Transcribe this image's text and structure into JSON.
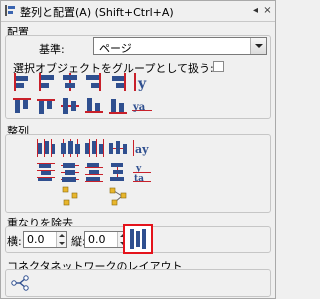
{
  "panel": {
    "title": "整列と配置(A) (Shift+Ctrl+A)",
    "title_icon": "align-panel-icon",
    "menu_button": "◂",
    "close_button": "×"
  },
  "arrange": {
    "section_label": "配置",
    "basis_label": "基準:",
    "basis_value": "ページ",
    "group_label": "選択オブジェクトをグループとして扱う:",
    "group_checked": false
  },
  "distribute": {
    "section_label": "整列"
  },
  "remove_overlap": {
    "section_label": "重なりを除去",
    "h_label": "横:",
    "h_value": "0.0",
    "v_label": "縦:",
    "v_value": "0.0"
  },
  "connector": {
    "section_label": "コネクタネットワークのレイアウト"
  },
  "colors": {
    "panel_bg": "#f0f0f0",
    "icon_blue": "#2f4f8f",
    "icon_red": "#c8202a",
    "highlight_red": "#e4131b",
    "node_yellow": "#e8b62c"
  }
}
